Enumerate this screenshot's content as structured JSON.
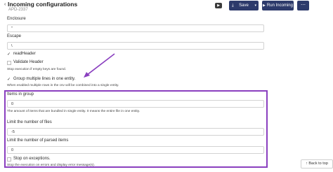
{
  "header": {
    "back_glyph": "‹",
    "title": "Incoming configurations",
    "subtitle": "APD-2337",
    "video_icon": "video-icon",
    "save_label": "Save",
    "save_caret": "▾",
    "save_icon": "⤓",
    "run_label": "Run Incoming",
    "run_icon": "▶",
    "more_label": "⋯"
  },
  "form": {
    "enclosure": {
      "label": "Enclosure",
      "value": "\""
    },
    "escape": {
      "label": "Escape",
      "value": "\\"
    },
    "read_header": {
      "label": "readHeader",
      "checked": true,
      "mark": "✓"
    },
    "validate_header": {
      "label": "Validate Header",
      "checked": false
    },
    "stop_empty_hint": "Stop execution if empty keys are found.",
    "group_multiple": {
      "label": "Group multiple lines in one entity.",
      "checked": true,
      "mark": "✓"
    },
    "group_hint": "When enabled multiple rows in the csv will be combined into a single entity.",
    "items_in_group": {
      "label": "Items in group",
      "value": "0",
      "hint": "The amount of items that are bundled in single entity. 0 means the entire file in one entity."
    },
    "limit_files": {
      "label": "Limit the number of files",
      "value": "-5"
    },
    "limit_parsed": {
      "label": "Limit the number of parsed items",
      "value": "0"
    },
    "stop_on_exceptions": {
      "label": "Stop on exceptions.",
      "checked": false,
      "hint": "Stop the execution on errors and display error message(s)."
    }
  },
  "back_to_top": {
    "label": "Back to top",
    "icon": "↑"
  },
  "colors": {
    "highlight": "#8a3fbf",
    "primary_button": "#2d3a6b"
  }
}
